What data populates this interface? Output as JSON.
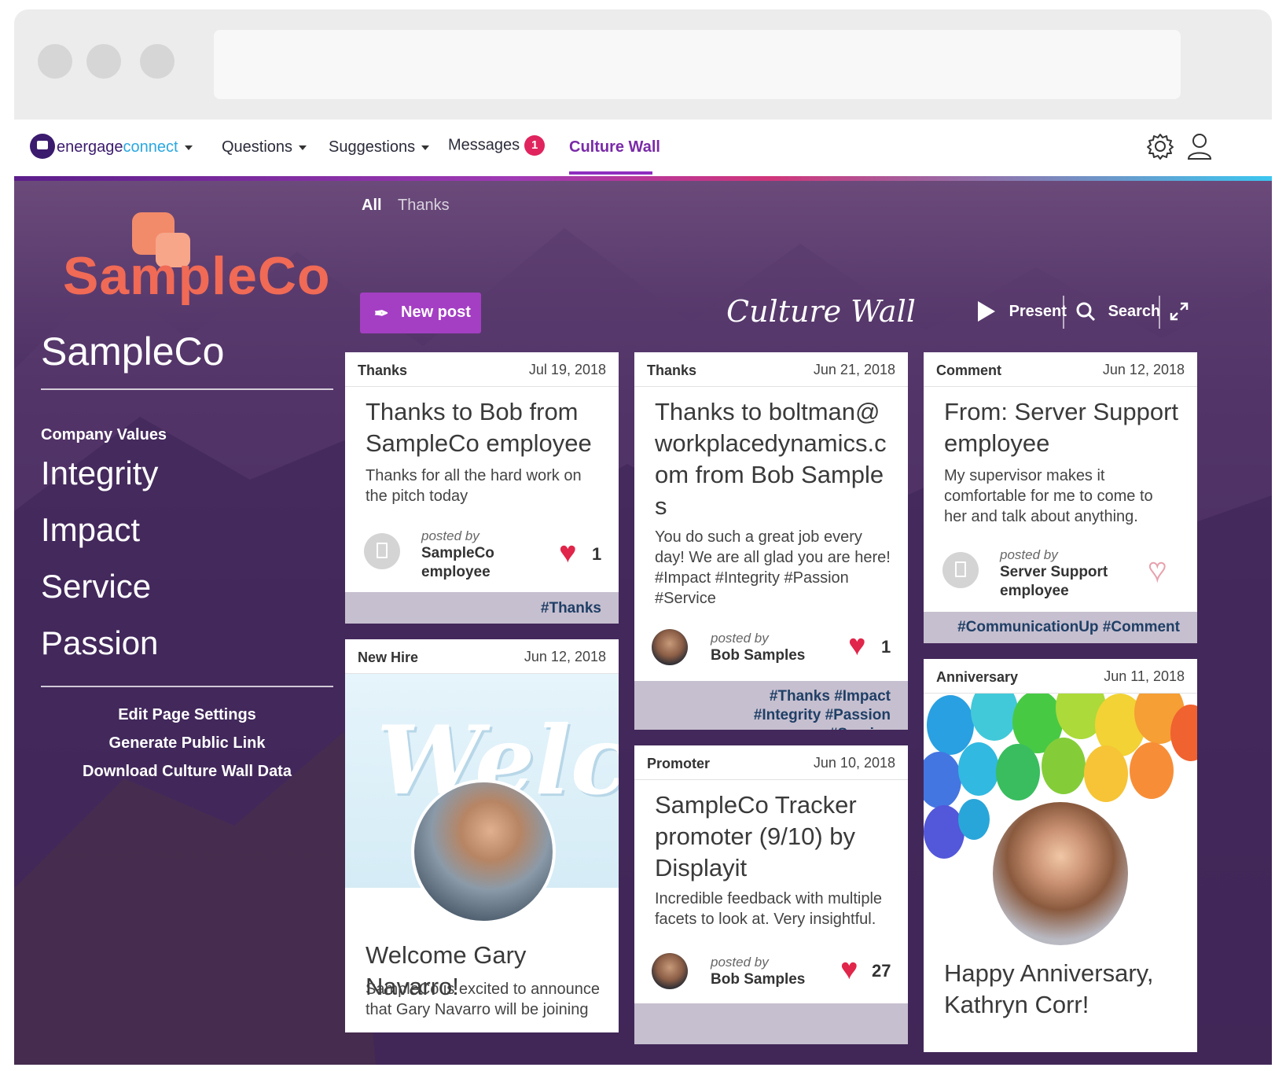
{
  "nav": {
    "brand_prefix": "energage",
    "brand_suffix": "connect",
    "questions": "Questions",
    "suggestions": "Suggestions",
    "messages": "Messages",
    "messages_badge": "1",
    "culture_wall": "Culture Wall"
  },
  "sidebar": {
    "logo_text": "SampleCo",
    "company_name": "SampleCo",
    "values_label": "Company Values",
    "values": [
      "Integrity",
      "Impact",
      "Service",
      "Passion"
    ],
    "links": [
      "Edit Page Settings",
      "Generate Public Link",
      "Download Culture Wall Data"
    ]
  },
  "filters": {
    "all": "All",
    "thanks": "Thanks"
  },
  "toolbar": {
    "new_post": "New post",
    "title": "Culture Wall",
    "present": "Present",
    "search": "Search"
  },
  "cards": [
    {
      "type": "Thanks",
      "date": "Jul 19, 2018",
      "title": "Thanks to Bob from SampleCo employee",
      "body": "Thanks for all the hard work on the pitch today",
      "posted_by": "posted by",
      "poster": "SampleCo employee",
      "likes": "1",
      "tags": "#Thanks"
    },
    {
      "type": "New Hire",
      "date": "Jun 12, 2018",
      "image_text": "Welcom",
      "title": "Welcome Gary Navarro!",
      "body": "SampleCo is excited to announce that Gary Navarro will be joining"
    },
    {
      "type": "Thanks",
      "date": "Jun 21, 2018",
      "title": "Thanks to boltman@workplacedynamics.com from Bob Samples",
      "body": "You do such a great job every day! We are all glad you are here! #Impact #Integrity #Passion #Service",
      "posted_by": "posted by",
      "poster": "Bob Samples",
      "likes": "1",
      "tags": "#Thanks #Impact #Integrity #Passion #Service"
    },
    {
      "type": "Promoter",
      "date": "Jun 10, 2018",
      "title": "SampleCo Tracker promoter (9/10) by Displayit",
      "body": "Incredible feedback with multiple facets to look at. Very insightful.",
      "posted_by": "posted by",
      "poster": "Bob Samples",
      "likes": "27"
    },
    {
      "type": "Comment",
      "date": "Jun 12, 2018",
      "title": "From: Server Support employee",
      "body": "My supervisor makes it comfortable for me to come to her and talk about anything.",
      "posted_by": "posted by",
      "poster": "Server Support employee",
      "tags": "#CommunicationUp #Comment"
    },
    {
      "type": "Anniversary",
      "date": "Jun 11, 2018",
      "title": "Happy Anniversary, Kathryn Corr!"
    }
  ],
  "colors": {
    "accent": "#a43fc4",
    "brand_logo": "#f06a55",
    "heart": "#e0264a",
    "tag_text": "#1f3f66",
    "tag_bar": "#c6bfcf"
  },
  "icons": {
    "settings": "gear-icon",
    "user": "user-icon",
    "present": "play-icon",
    "search": "search-icon",
    "expand": "expand-icon",
    "new_post": "feather-icon"
  }
}
